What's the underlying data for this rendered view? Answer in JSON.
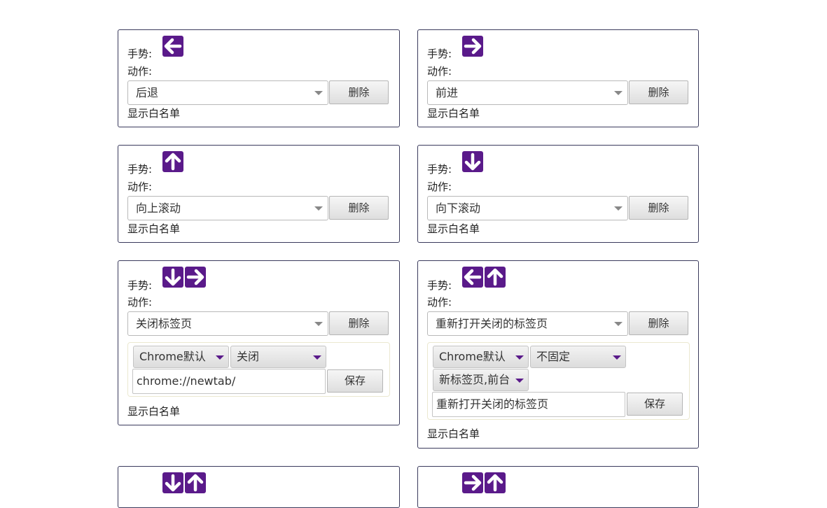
{
  "labels": {
    "gesture": "手势:",
    "action": "动作:",
    "whitelist": "显示白名单",
    "delete": "删除",
    "save": "保存"
  },
  "icons": {
    "left": "arrow-left-icon",
    "right": "arrow-right-icon",
    "up": "arrow-up-icon",
    "down": "arrow-down-icon",
    "color": "#5a1a8a"
  },
  "cards": [
    {
      "gesture": [
        "left"
      ],
      "action": "后退"
    },
    {
      "gesture": [
        "right"
      ],
      "action": "前进"
    },
    {
      "gesture": [
        "up"
      ],
      "action": "向上滚动"
    },
    {
      "gesture": [
        "down"
      ],
      "action": "向下滚动"
    },
    {
      "gesture": [
        "down",
        "right"
      ],
      "action": "关闭标签页",
      "options": [
        "Chrome默认",
        "关闭"
      ],
      "input_value": "chrome://newtab/"
    },
    {
      "gesture": [
        "left",
        "up"
      ],
      "action": "重新打开关闭的标签页",
      "options": [
        "Chrome默认",
        "不固定",
        "新标签页,前台"
      ],
      "input_value": "重新打开关闭的标签页"
    }
  ]
}
